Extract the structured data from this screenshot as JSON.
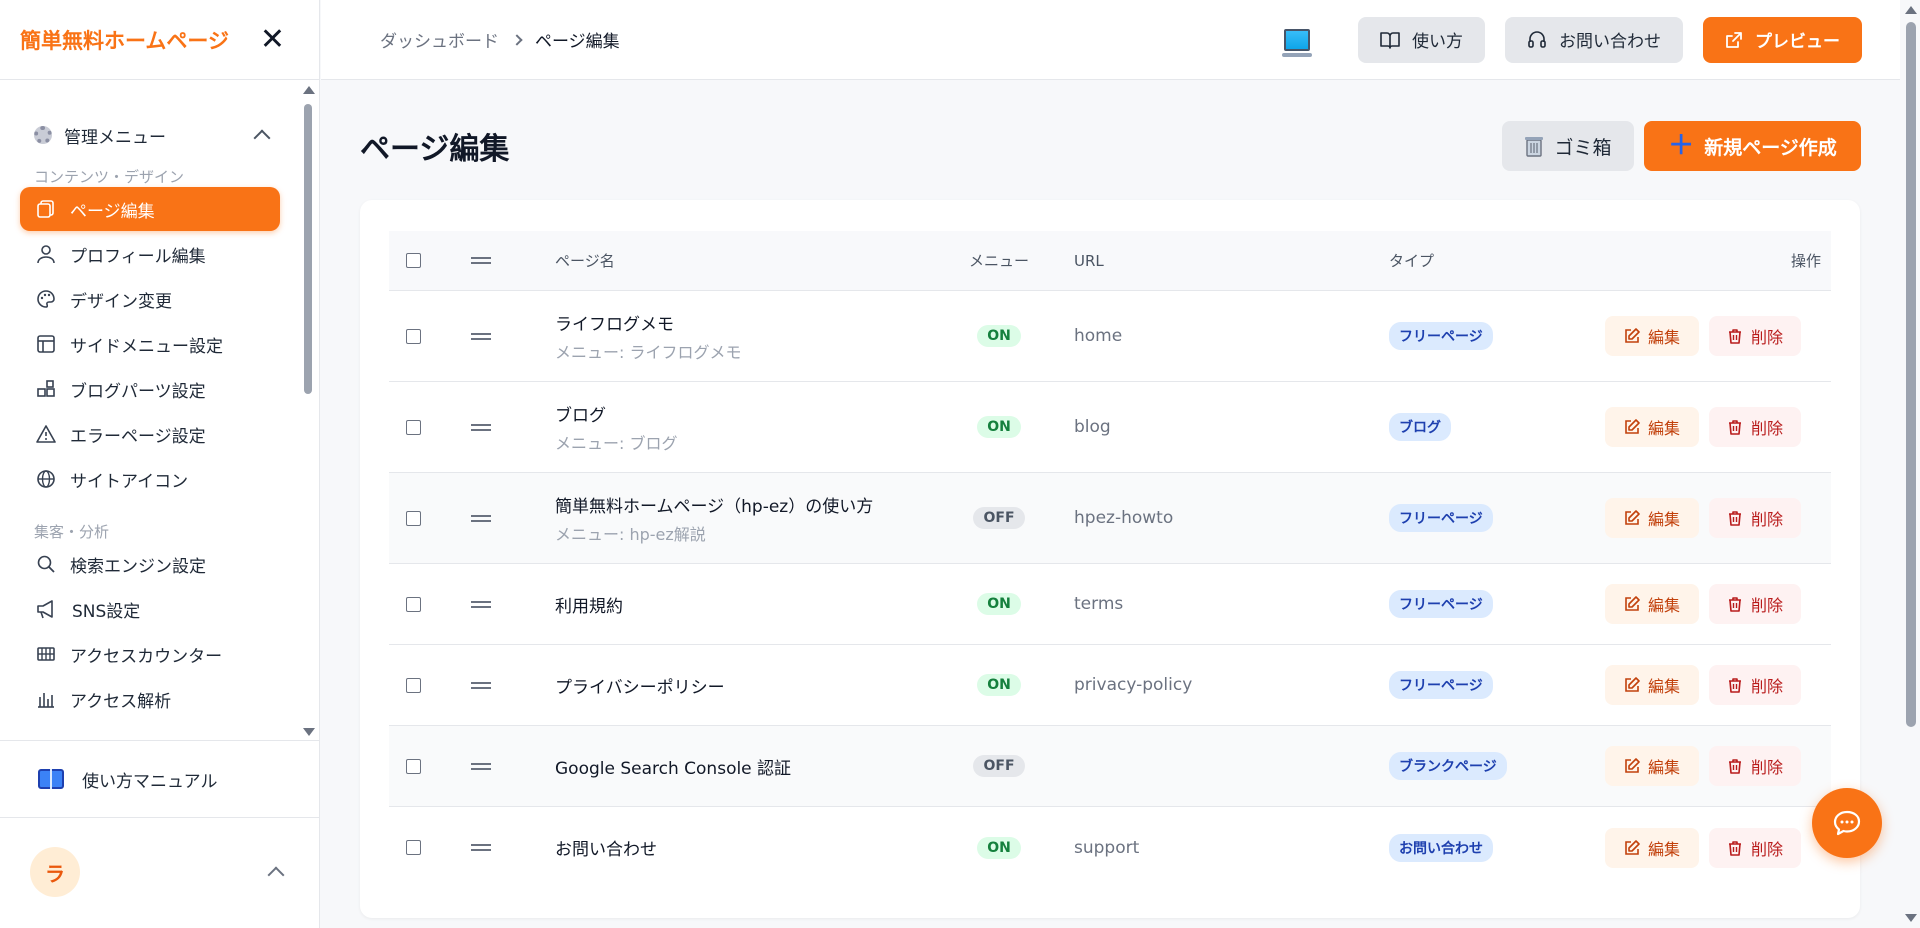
{
  "app": {
    "brand": "簡単無料ホームページ"
  },
  "sidebar": {
    "admin_menu_label": "管理メニュー",
    "group_content": "コンテンツ・デザイン",
    "group_analytics": "集客・分析",
    "items": [
      {
        "label": "ページ編集",
        "icon": "pages-icon",
        "active": true
      },
      {
        "label": "プロフィール編集",
        "icon": "user-icon"
      },
      {
        "label": "デザイン変更",
        "icon": "palette-icon"
      },
      {
        "label": "サイドメニュー設定",
        "icon": "layout-icon"
      },
      {
        "label": "ブログパーツ設定",
        "icon": "blocks-icon"
      },
      {
        "label": "エラーページ設定",
        "icon": "warning-icon"
      },
      {
        "label": "サイトアイコン",
        "icon": "globe-icon"
      }
    ],
    "items2": [
      {
        "label": "検索エンジン設定",
        "icon": "search-icon"
      },
      {
        "label": "SNS設定",
        "icon": "megaphone-icon"
      },
      {
        "label": "アクセスカウンター",
        "icon": "grid-icon"
      },
      {
        "label": "アクセス解析",
        "icon": "bar-chart-icon"
      }
    ],
    "manual_label": "使い方マニュアル",
    "user_initial": "ラ"
  },
  "header": {
    "breadcrumb": [
      "ダッシュボード",
      "ページ編集"
    ],
    "howto_label": "使い方",
    "contact_label": "お問い合わせ",
    "preview_label": "プレビュー"
  },
  "main": {
    "title": "ページ編集",
    "trash_label": "ゴミ箱",
    "new_page_label": "新規ページ作成",
    "columns": {
      "name": "ページ名",
      "menu": "メニュー",
      "url": "URL",
      "type": "タイプ",
      "ops": "操作"
    },
    "edit_label": "編集",
    "delete_label": "削除",
    "rows": [
      {
        "name": "ライフログメモ",
        "sub": "メニュー: ライフログメモ",
        "menu": "ON",
        "url": "home",
        "type": "フリーページ"
      },
      {
        "name": "ブログ",
        "sub": "メニュー: ブログ",
        "menu": "ON",
        "url": "blog",
        "type": "ブログ"
      },
      {
        "name": "簡単無料ホームページ（hp-ez）の使い方",
        "sub": "メニュー: hp-ez解説",
        "menu": "OFF",
        "url": "hpez-howto",
        "type": "フリーページ"
      },
      {
        "name": "利用規約",
        "sub": "",
        "menu": "ON",
        "url": "terms",
        "type": "フリーページ"
      },
      {
        "name": "プライバシーポリシー",
        "sub": "",
        "menu": "ON",
        "url": "privacy-policy",
        "type": "フリーページ"
      },
      {
        "name": "Google Search Console 認証",
        "sub": "",
        "menu": "OFF",
        "url": "",
        "type": "ブランクページ"
      },
      {
        "name": "お問い合わせ",
        "sub": "",
        "menu": "ON",
        "url": "support",
        "type": "お問い合わせ"
      }
    ]
  },
  "colors": {
    "accent": "#f97316",
    "on": "#15803d",
    "type_badge": "#1e40af"
  }
}
